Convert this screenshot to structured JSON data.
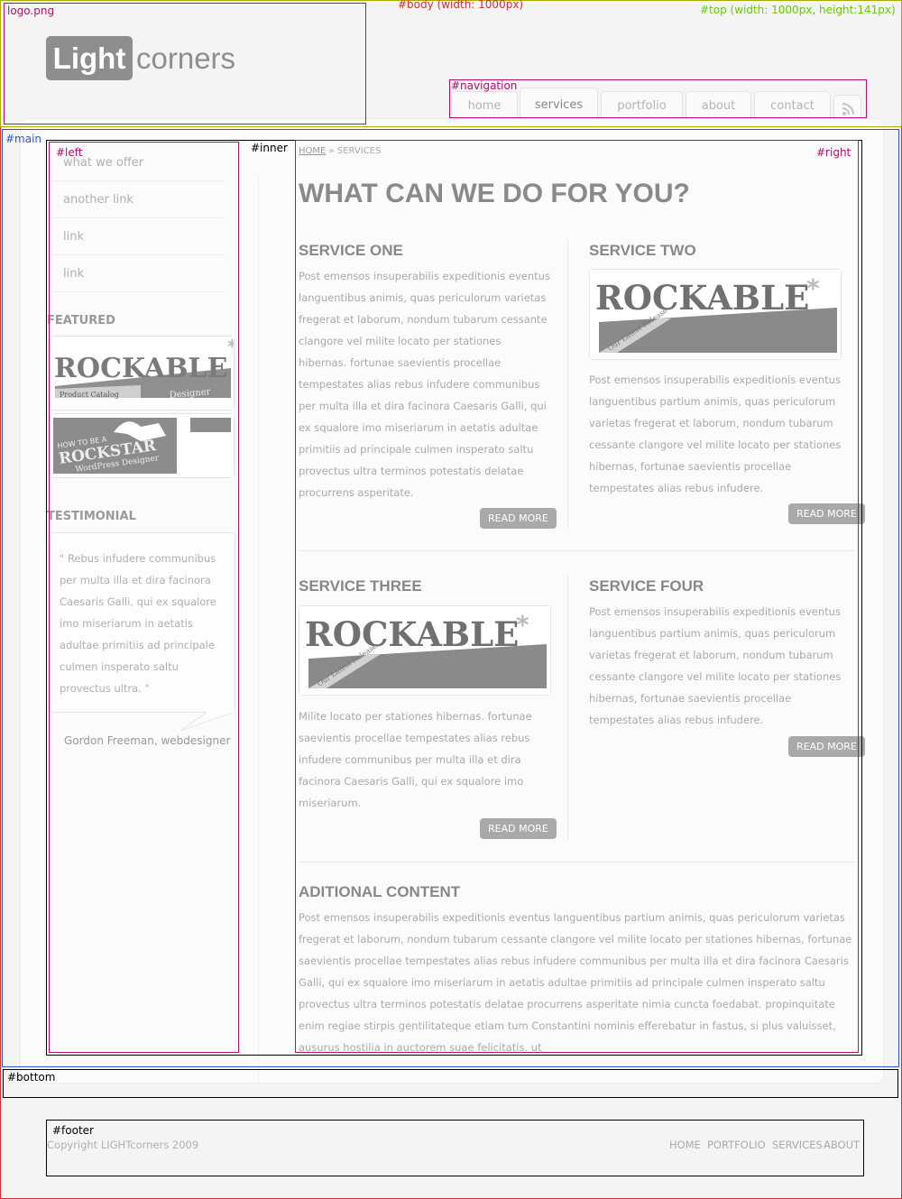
{
  "frame_labels": {
    "logo": "logo.png",
    "body": "#body (width: 1000px)",
    "top": "#top (width: 1000px, height:141px)",
    "navigation": "#navigation",
    "main": "#main",
    "left": "#left",
    "inner": "#inner",
    "right": "#right",
    "bottom": "#bottom",
    "footer": "#footer"
  },
  "logo": {
    "light": "Light",
    "corners": "corners"
  },
  "navigation": {
    "tabs": [
      {
        "label": "home"
      },
      {
        "label": "services",
        "active": true
      },
      {
        "label": "portfolio"
      },
      {
        "label": "about"
      },
      {
        "label": "contact"
      }
    ],
    "rss_icon": "rss-icon"
  },
  "sidebar": {
    "links": [
      "what we offer",
      "another link",
      "link",
      "link"
    ],
    "featured_heading": "FEATURED",
    "featured_images": [
      {
        "title": "ROCKABLE",
        "caption": "Product Catalog",
        "caption2": "Designer"
      },
      {
        "line1": "HOW TO BE A",
        "line2": "ROCKSTAR",
        "line3": "WordPress Designer"
      }
    ],
    "testimonial_heading": "TESTIMONIAL",
    "testimonial_quote": "\" Rebus infudere communibus per multa illa et dira facinora Caesaris Galli, qui ex squalore imo miseriarum in aetatis adultae primitiis ad principale culmen insperato saltu provectus ultra. \"",
    "testimonial_author": "Gordon Freeman, webdesigner"
  },
  "breadcrumb": {
    "home": "HOME",
    "separator": "»",
    "current": "SERVICES"
  },
  "page_title": "WHAT CAN WE DO FOR YOU?",
  "services": [
    {
      "title": "SERVICE ONE",
      "text": "Post emensos insuperabilis expeditionis eventus languentibus animis, quas periculorum varietas fregerat et laborum, nondum tubarum cessante clangore vel milite locato per stationes hibernas. fortunae saevientis procellae tempestates alias rebus infudere communibus per multa illa et dira facinora Caesaris Galli, qui ex squalore imo miseriarum in aetatis adultae primitiis ad principale culmen insperato saltu provectus ultra terminos potestatis delatae procurrens asperitate.",
      "button": "READ MORE"
    },
    {
      "title": "SERVICE TWO",
      "text": "Post emensos insuperabilis expeditionis eventus languentibus partium animis, quas periculorum varietas fregerat et laborum, nondum tubarum cessante clangore vel milite locato per stationes hibernas, fortunae saevientis procellae tempestates alias rebus infudere.",
      "button": "READ MORE",
      "image": {
        "title": "ROCKABLE",
        "ribbon": "Our Latest Release"
      }
    },
    {
      "title": "SERVICE THREE",
      "text": "Milite locato per stationes hibernas. fortunae saevientis procellae tempestates alias rebus infudere communibus per multa illa et dira facinora Caesaris Galli, qui ex squalore imo miseriarum.",
      "button": "READ MORE",
      "image": {
        "title": "ROCKABLE",
        "ribbon": "Our Latest Release"
      }
    },
    {
      "title": "SERVICE FOUR",
      "text": "Post emensos insuperabilis expeditionis eventus languentibus partium animis, quas periculorum varietas fregerat et laborum, nondum tubarum cessante clangore vel milite locato per stationes hibernas, fortunae saevientis procellae tempestates alias rebus infudere.",
      "button": "READ MORE"
    }
  ],
  "additional": {
    "title": "ADITIONAL CONTENT",
    "text": "Post emensos insuperabilis expeditionis eventus languentibus partium animis, quas periculorum varietas fregerat et laborum, nondum tubarum cessante clangore vel milite locato per stationes hibernas, fortunae saevientis procellae tempestates alias rebus infudere communibus per multa illa et dira facinora Caesaris Galli, qui ex squalore imo miseriarum in aetatis adultae primitiis ad principale culmen insperato saltu provectus ultra terminos potestatis delatae procurrens asperitate nimia cuncta foedabat. propinquitate enim regiae stirpis gentilitateque etiam tum Constantini nominis efferebatur in fastus, si plus valuisset, ausurus hostilia in auctorem suae felicitatis, ut"
  },
  "footer": {
    "copyright": "Copyright LIGHTcorners 2009",
    "links": [
      "HOME",
      "PORTFOLIO",
      "SERVICES",
      "ABOUT"
    ]
  },
  "colors": {
    "page_bg": "#f4f4f4",
    "panel_bg": "#fbfbfb",
    "accent_gray": "#8e8e8e",
    "button_gray": "#a9a9a9",
    "frame_magenta": "#b0106e",
    "frame_blue": "#2b58c8",
    "frame_green": "#66cc00",
    "frame_red": "#cc3333"
  }
}
